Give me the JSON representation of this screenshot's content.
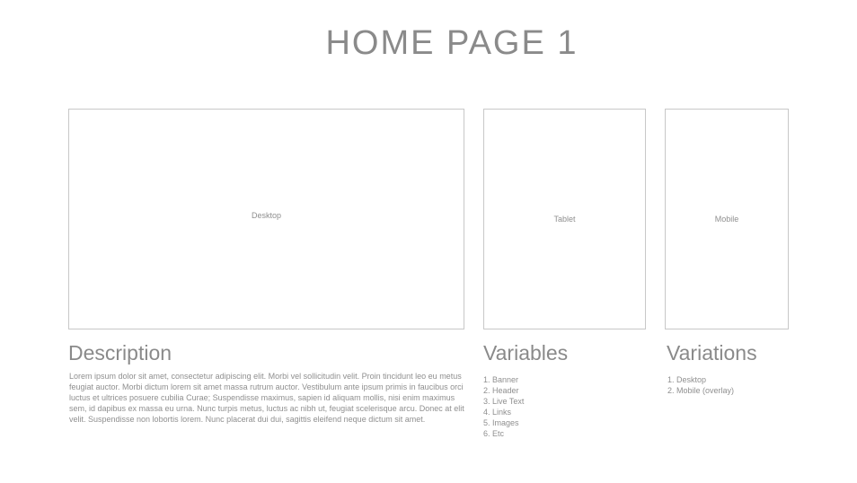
{
  "page": {
    "title": "HOME PAGE 1"
  },
  "frames": {
    "desktop": "Desktop",
    "tablet": "Tablet",
    "mobile": "Mobile"
  },
  "description": {
    "heading": "Description",
    "text": "Lorem ipsum dolor sit amet, consectetur adipiscing elit. Morbi vel sollicitudin velit. Proin tincidunt leo eu metus feugiat auctor. Morbi dictum lorem sit amet massa rutrum auctor. Vestibulum ante ipsum primis in faucibus orci luctus et ultrices posuere cubilia Curae; Suspendisse maximus, sapien id aliquam mollis, nisi enim maximus sem, id dapibus ex massa eu urna. Nunc turpis metus, luctus ac nibh ut, feugiat scelerisque arcu. Donec at elit velit. Suspendisse non lobortis lorem. Nunc placerat dui dui, sagittis eleifend neque dictum sit amet."
  },
  "variables": {
    "heading": "Variables",
    "items": [
      "1. Banner",
      "2. Header",
      "3. Live Text",
      "4. Links",
      "5. Images",
      "6. Etc"
    ]
  },
  "variations": {
    "heading": "Variations",
    "items": [
      "1. Desktop",
      "2. Mobile (overlay)"
    ]
  }
}
